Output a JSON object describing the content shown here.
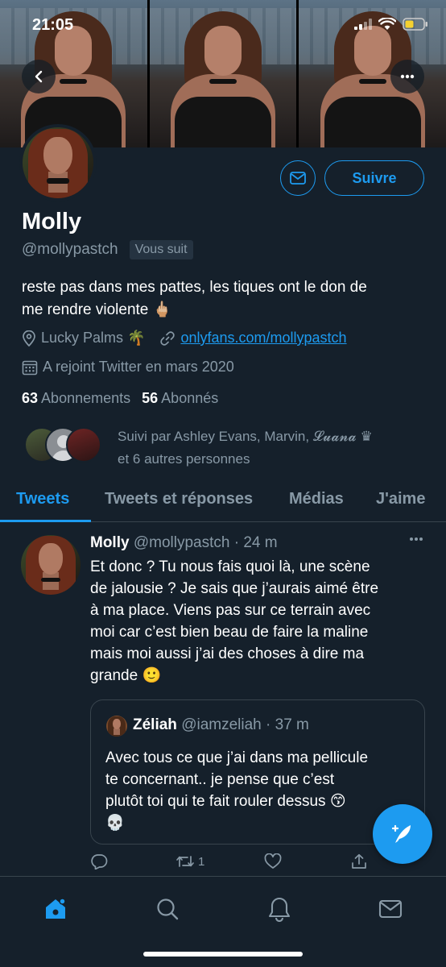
{
  "status_bar": {
    "time": "21:05"
  },
  "profile": {
    "name": "Molly",
    "handle": "@mollypastch",
    "follows_you_badge": "Vous suit",
    "bio_line1": "reste pas dans mes pattes, les tiques ont le don de",
    "bio_line2": "me rendre violente 🖕🏼",
    "location": "Lucky Palms 🌴",
    "website": "onlyfans.com/mollypastch",
    "joined": "A rejoint Twitter en mars 2020",
    "following_count": "63",
    "following_label": "Abonnements",
    "followers_count": "56",
    "followers_label": "Abonnés",
    "followed_by_line1": "Suivi par Ashley Evans, Marvin, 𝓛𝓾𝓪𝓷𝓪 ♛",
    "followed_by_line2": "et 6 autres personnes",
    "follow_button": "Suivre"
  },
  "tabs": [
    {
      "label": "Tweets",
      "active": true
    },
    {
      "label": "Tweets et réponses",
      "active": false
    },
    {
      "label": "Médias",
      "active": false
    },
    {
      "label": "J'aime",
      "active": false
    }
  ],
  "tweet": {
    "author_name": "Molly",
    "author_handle": "@mollypastch",
    "time": "· 24 m",
    "lines": [
      "Et donc ? Tu nous fais quoi là, une scène",
      "de jalousie ? Je sais que j’aurais aimé être",
      "à ma place. Viens pas sur ce terrain avec",
      "moi car c’est bien beau de faire la maline",
      "mais moi aussi j’ai des choses à dire ma",
      "grande 🙂"
    ],
    "quote": {
      "author_name": "Zéliah",
      "author_handle": "@iamzeliah",
      "time": "· 37 m",
      "lines": [
        "Avec tous ce que j’ai dans ma pellicule",
        "te concernant.. je pense que c’est",
        "plutôt toi qui te fait rouler dessus 😙",
        "💀"
      ]
    },
    "retweet_count": "1"
  },
  "icons": {
    "back": "chevron-left-icon",
    "more": "more-horizontal-icon",
    "message": "envelope-icon",
    "location": "location-pin-icon",
    "link": "link-icon",
    "calendar": "calendar-icon",
    "reply": "reply-icon",
    "retweet": "retweet-icon",
    "like": "heart-icon",
    "share": "share-icon",
    "compose": "compose-feather-icon",
    "home": "home-icon",
    "search": "search-icon",
    "notifications": "bell-icon",
    "messages": "mail-icon"
  },
  "colors": {
    "background": "#15202b",
    "accent": "#1d9bf0",
    "secondary_text": "#8899a6",
    "border": "#38444d"
  }
}
